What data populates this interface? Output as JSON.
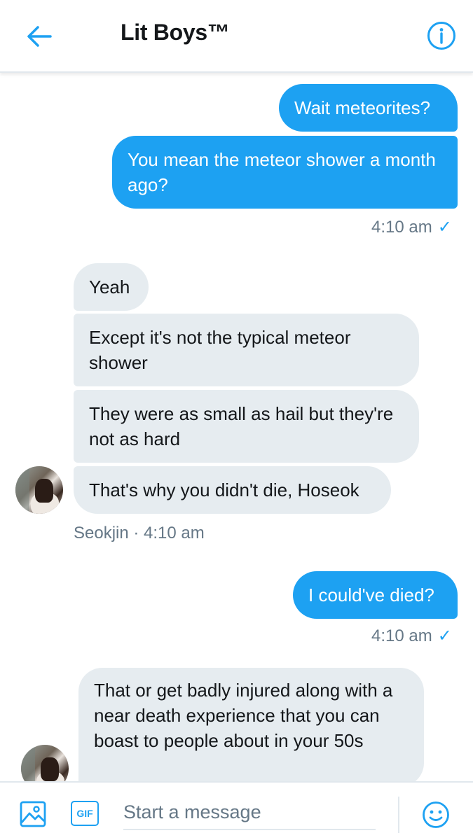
{
  "header": {
    "title": "Lit Boys™"
  },
  "messages": [
    {
      "dir": "out",
      "text": "Wait meteorites?"
    },
    {
      "dir": "out",
      "text": "You mean the meteor shower a month ago?"
    },
    {
      "dir": "in",
      "text": "Yeah"
    },
    {
      "dir": "in",
      "text": "Except it's not the typical meteor shower"
    },
    {
      "dir": "in",
      "text": "They were as small as hail but they're not as hard"
    },
    {
      "dir": "in",
      "text": "That's why you didn't die, Hoseok"
    },
    {
      "dir": "out",
      "text": "I could've died?"
    },
    {
      "dir": "in",
      "text": "That or get badly injured along with a near death experience that you can boast to people about in your 50s"
    }
  ],
  "meta": {
    "out_time_1": "4:10 am",
    "in_sender_1": "Seokjin · 4:10 am",
    "out_time_2": "4:10 am",
    "check": "✓"
  },
  "composer": {
    "gif_label": "GIF",
    "placeholder": "Start a message"
  },
  "icons": {
    "back": "arrow-left-icon",
    "info": "info-icon",
    "image": "image-icon",
    "gif": "gif-icon",
    "emoji": "emoji-icon"
  },
  "colors": {
    "accent": "#1da1f2",
    "incoming_bubble": "#e6ecf0",
    "meta_text": "#657786"
  }
}
